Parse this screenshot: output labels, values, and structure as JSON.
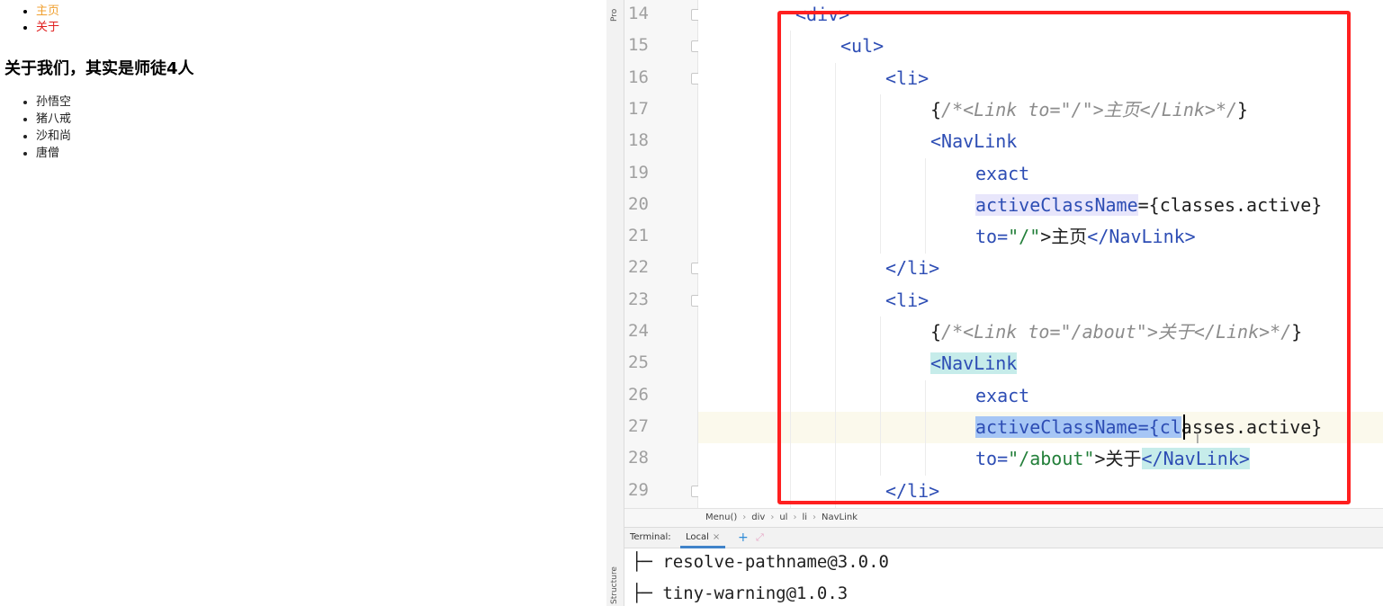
{
  "browser": {
    "nav": [
      {
        "label": "主页",
        "color": "#f0a030"
      },
      {
        "label": "关于",
        "color": "#e02020"
      }
    ],
    "heading": "关于我们，其实是师徒4人",
    "members": [
      "孙悟空",
      "猪八戒",
      "沙和尚",
      "唐僧"
    ]
  },
  "ide": {
    "side_tabs": {
      "project": "Pro",
      "structure": "Structure"
    },
    "lines": [
      {
        "num": "14",
        "indent": 0,
        "current": false,
        "fold": true,
        "tokens": [
          {
            "t": "<div>",
            "c": "t-tag"
          }
        ]
      },
      {
        "num": "15",
        "indent": 1,
        "current": false,
        "fold": true,
        "tokens": [
          {
            "t": "<ul>",
            "c": "t-tag"
          }
        ]
      },
      {
        "num": "16",
        "indent": 2,
        "current": false,
        "fold": true,
        "tokens": [
          {
            "t": "<li>",
            "c": "t-tag"
          }
        ]
      },
      {
        "num": "17",
        "indent": 3,
        "current": false,
        "fold": false,
        "tokens": [
          {
            "t": "{",
            "c": "t-plain"
          },
          {
            "t": "/*<Link to=\"/\">主页</Link>*/",
            "c": "t-comment"
          },
          {
            "t": "}",
            "c": "t-plain"
          }
        ]
      },
      {
        "num": "18",
        "indent": 3,
        "current": false,
        "fold": false,
        "tokens": [
          {
            "t": "<NavLink",
            "c": "t-tag"
          }
        ]
      },
      {
        "num": "19",
        "indent": 4,
        "current": false,
        "fold": false,
        "tokens": [
          {
            "t": "exact",
            "c": "t-attr"
          }
        ]
      },
      {
        "num": "20",
        "indent": 4,
        "current": false,
        "fold": false,
        "tokens": [
          {
            "t": "activeClassName",
            "c": "t-attr t-hl-attr"
          },
          {
            "t": "=",
            "c": "t-plain"
          },
          {
            "t": "{classes.active}",
            "c": "t-plain"
          }
        ]
      },
      {
        "num": "21",
        "indent": 4,
        "current": false,
        "fold": false,
        "tokens": [
          {
            "t": "to=",
            "c": "t-attr"
          },
          {
            "t": "\"/\"",
            "c": "t-str"
          },
          {
            "t": ">主页",
            "c": "t-plain"
          },
          {
            "t": "</NavLink>",
            "c": "t-tag"
          }
        ]
      },
      {
        "num": "22",
        "indent": 2,
        "current": false,
        "fold": true,
        "tokens": [
          {
            "t": "</li>",
            "c": "t-tag"
          }
        ]
      },
      {
        "num": "23",
        "indent": 2,
        "current": false,
        "fold": true,
        "tokens": [
          {
            "t": "<li>",
            "c": "t-tag"
          }
        ]
      },
      {
        "num": "24",
        "indent": 3,
        "current": false,
        "fold": false,
        "tokens": [
          {
            "t": "{",
            "c": "t-plain"
          },
          {
            "t": "/*<Link to=\"/about\">关于</Link>*/",
            "c": "t-comment"
          },
          {
            "t": "}",
            "c": "t-plain"
          }
        ]
      },
      {
        "num": "25",
        "indent": 3,
        "current": false,
        "fold": false,
        "tokens": [
          {
            "t": "<NavLink",
            "c": "t-tag t-hl-tag"
          }
        ]
      },
      {
        "num": "26",
        "indent": 4,
        "current": false,
        "fold": false,
        "tokens": [
          {
            "t": "exact",
            "c": "t-attr"
          }
        ]
      },
      {
        "num": "27",
        "indent": 4,
        "current": true,
        "fold": false,
        "tokens": [
          {
            "t": "activeClassName={cl",
            "c": "t-attr t-hl-sel"
          },
          {
            "t": "asses.active}",
            "c": "t-plain"
          }
        ]
      },
      {
        "num": "28",
        "indent": 4,
        "current": false,
        "fold": false,
        "tokens": [
          {
            "t": "to=",
            "c": "t-attr"
          },
          {
            "t": "\"/about\"",
            "c": "t-str"
          },
          {
            "t": ">关于",
            "c": "t-plain"
          },
          {
            "t": "</NavLink>",
            "c": "t-tag t-hl-tag"
          }
        ]
      },
      {
        "num": "29",
        "indent": 2,
        "current": false,
        "fold": true,
        "tokens": [
          {
            "t": "</li>",
            "c": "t-tag"
          }
        ]
      }
    ],
    "breadcrumb": [
      "Menu()",
      "div",
      "ul",
      "li",
      "NavLink"
    ],
    "terminal": {
      "label": "Terminal:",
      "tab": "Local",
      "tab_close": "×",
      "add": "+",
      "expand": "⤢",
      "lines": [
        "├─ resolve-pathname@3.0.0",
        "├─ tiny-warning@1.0.3"
      ]
    }
  },
  "colors": {
    "highlight_box": "#ff1f1f"
  }
}
